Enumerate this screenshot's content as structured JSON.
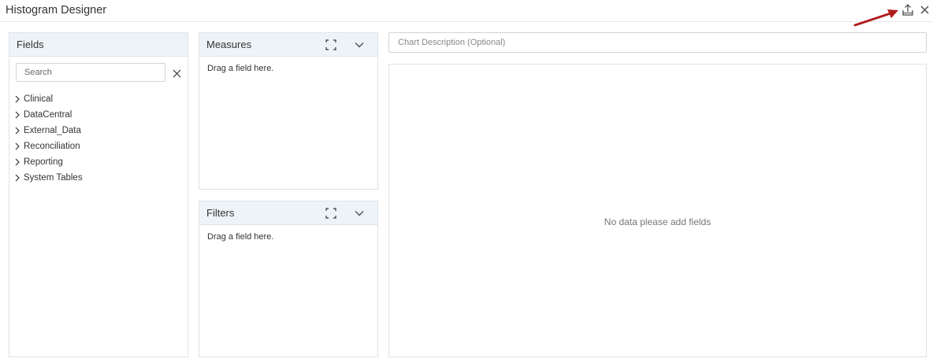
{
  "window": {
    "title": "Histogram Designer",
    "export_icon": "export-upload-icon",
    "close_icon": "close-icon",
    "arrow_color": "#b01c1c"
  },
  "fields_panel": {
    "title": "Fields",
    "search_placeholder": "Search",
    "items": [
      {
        "label": "Clinical"
      },
      {
        "label": "DataCentral"
      },
      {
        "label": "External_Data"
      },
      {
        "label": "Reconciliation"
      },
      {
        "label": "Reporting"
      },
      {
        "label": "System Tables"
      }
    ]
  },
  "measures_panel": {
    "title": "Measures",
    "drop_hint": "Drag a field here."
  },
  "filters_panel": {
    "title": "Filters",
    "drop_hint": "Drag a field here."
  },
  "chart": {
    "description_placeholder": "Chart Description (Optional)",
    "empty_message": "No data please add fields"
  },
  "colors": {
    "panel_header_bg": "#eef3f8",
    "border": "#dfe3e8"
  }
}
